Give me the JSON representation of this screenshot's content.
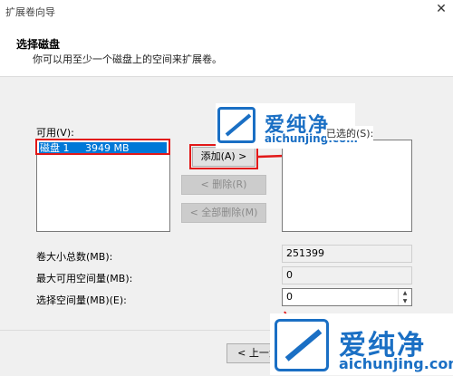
{
  "window": {
    "title": "扩展卷向导",
    "close_glyph": "✕"
  },
  "header": {
    "title": "选择磁盘",
    "subtitle": "你可以用至少一个磁盘上的空间来扩展卷。"
  },
  "available": {
    "label": "可用(V):",
    "items": [
      {
        "label": "磁盘 1     3949 MB"
      }
    ]
  },
  "selected": {
    "label": "已选的(S):"
  },
  "buttons": {
    "add": "添加(A) >",
    "remove": "< 删除(R)",
    "remove_all": "< 全部删除(M)",
    "back": "< 上一步"
  },
  "fields": {
    "total": {
      "label": "卷大小总数(MB):",
      "value": "251399"
    },
    "max": {
      "label": "最大可用空间量(MB):",
      "value": "0"
    },
    "select": {
      "label": "选择空间量(MB)(E):",
      "value": "0"
    }
  },
  "watermark": {
    "brand": "爱纯净",
    "url": "aichunjing.com"
  },
  "colors": {
    "selection": "#0078d7",
    "highlight": "#e21818",
    "brand": "#1a6fc4"
  }
}
